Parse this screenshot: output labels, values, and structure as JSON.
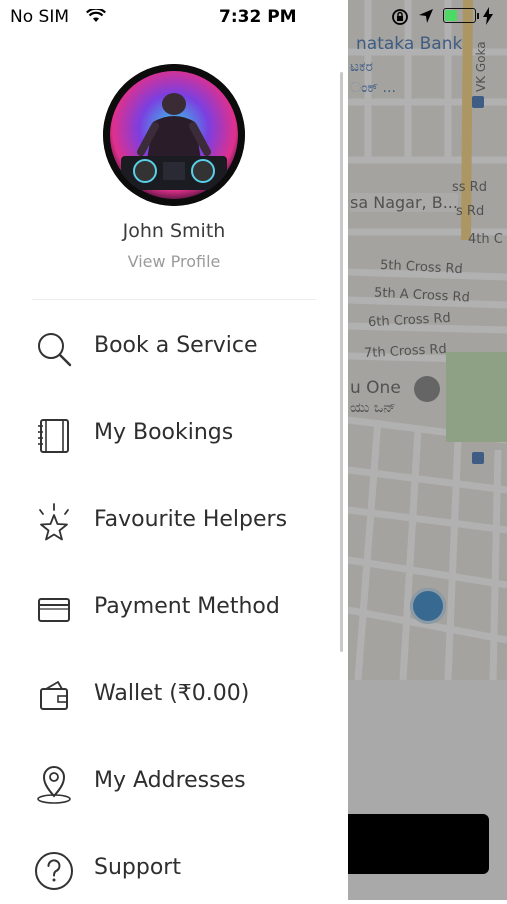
{
  "status_bar": {
    "carrier": "No SIM",
    "time": "7:32 PM",
    "battery_level": 0.4,
    "battery_color": "#4cd964"
  },
  "profile": {
    "name": "John Smith",
    "link": "View Profile",
    "avatar_icon": "dj-avatar"
  },
  "menu": [
    {
      "label": "Book a Service",
      "icon": "search-icon"
    },
    {
      "label": "My Bookings",
      "icon": "notebook-icon"
    },
    {
      "label": "Favourite Helpers",
      "icon": "star-icon"
    },
    {
      "label": "Payment Method",
      "icon": "card-icon"
    },
    {
      "label": "Wallet (₹0.00)",
      "icon": "wallet-icon"
    },
    {
      "label": "My Addresses",
      "icon": "location-pin-icon"
    },
    {
      "label": "Support",
      "icon": "help-icon"
    }
  ],
  "map": {
    "labels": {
      "bank": "nataka Bank",
      "kannada1": "ಟಕರ",
      "kannada2": "ಂಕ್ ...",
      "vk": "VK Goka",
      "ss_rd": "ss Rd",
      "nagar": "sa Nagar, B...",
      "s_rd": "s Rd",
      "fourth": "4th C",
      "fifth_cross": "5th Cross Rd",
      "fifth_a_cross": "5th A Cross Rd",
      "sixth_cross": "6th Cross Rd",
      "seventh_cross": "7th Cross Rd",
      "u_one": "u One",
      "kannada3": "ಯು ಒನ್"
    }
  }
}
